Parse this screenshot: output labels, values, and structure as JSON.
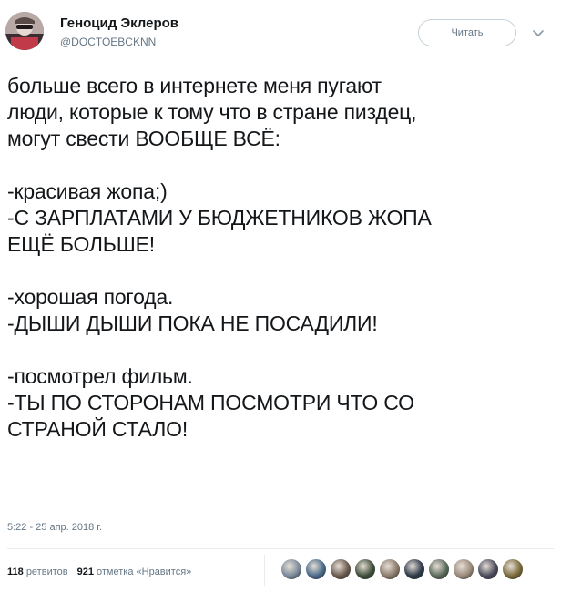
{
  "author": {
    "name": "Геноцид Эклеров",
    "handle": "@DOCTOEBCKNN"
  },
  "follow_button": {
    "label": "Читать"
  },
  "tweet": {
    "lines": [
      "больше всего в интернете меня пугают",
      "люди, которые к тому что в стране пиздец,",
      "могут свести ВООБЩЕ ВСЁ:",
      "",
      "-красивая жопа;)",
      "-С ЗАРПЛАТАМИ У БЮДЖЕТНИКОВ ЖОПА",
      "ЕЩЁ БОЛЬШЕ!",
      "",
      "-хорошая погода.",
      "-ДЫШИ ДЫШИ ПОКА НЕ ПОСАДИЛИ!",
      "",
      "-посмотрел фильм.",
      "-ТЫ ПО СТОРОНАМ ПОСМОТРИ ЧТО СО",
      "СТРАНОЙ СТАЛО!"
    ],
    "timestamp": "5:22 - 25 апр. 2018 г."
  },
  "stats": {
    "retweets_count": "118",
    "retweets_label": "ретвитов",
    "likes_count": "921",
    "likes_label": "отметка «Нравится»"
  },
  "likers": {
    "colors": [
      "#7a8a99",
      "#4a6a8a",
      "#6b5a4e",
      "#3f4f3a",
      "#8a7a6a",
      "#2e3a4a",
      "#5a6a5a",
      "#9a8a7a",
      "#4a4a5a",
      "#7a6a3a"
    ]
  },
  "colors": {
    "text": "#14171a",
    "muted": "#657786",
    "border": "#c7d1d8"
  }
}
